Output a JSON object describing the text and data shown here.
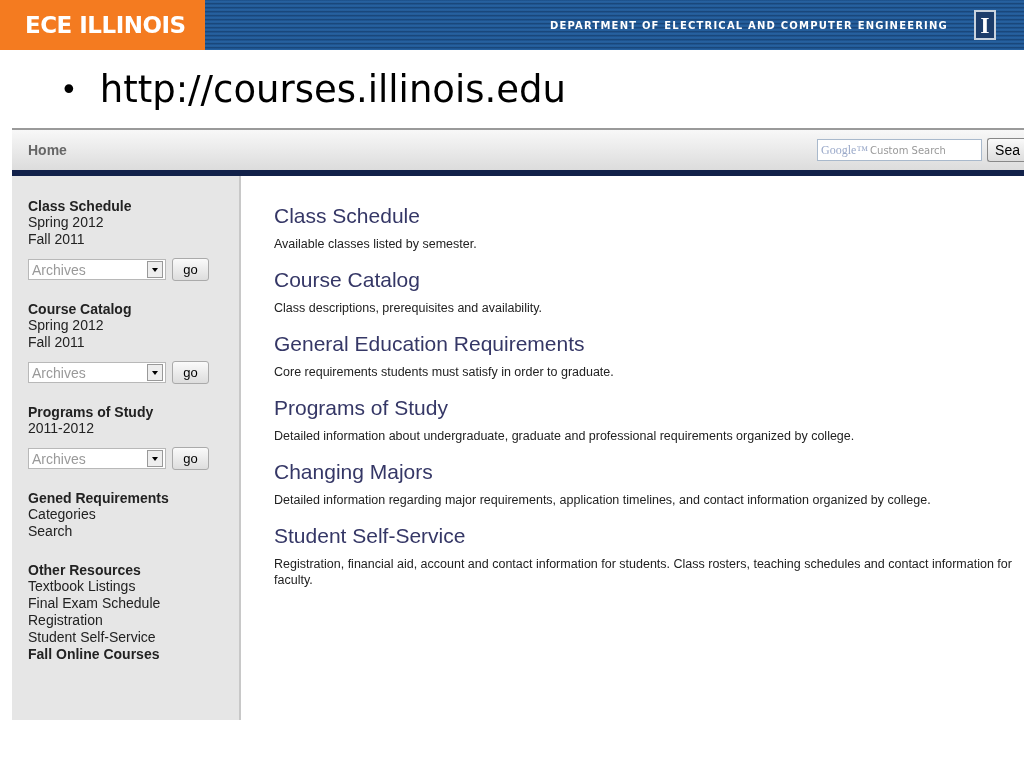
{
  "banner": {
    "logo": "ECE ILLINOIS",
    "department": "DEPARTMENT OF ELECTRICAL AND COMPUTER ENGINEERING",
    "emblem": "I"
  },
  "bullet": {
    "marker": "•",
    "text": "http://courses.illinois.edu"
  },
  "site": {
    "nav": {
      "home": "Home",
      "search_brand": "Google™",
      "search_placeholder": "Custom Search",
      "search_button": "Sea"
    },
    "sidebar": [
      {
        "title": "Class Schedule",
        "links": [
          {
            "label": "Spring 2012",
            "bold": false
          },
          {
            "label": "Fall 2011",
            "bold": false
          }
        ],
        "archive": {
          "placeholder": "Archives",
          "button": "go"
        }
      },
      {
        "title": "Course Catalog",
        "links": [
          {
            "label": "Spring 2012",
            "bold": false
          },
          {
            "label": "Fall 2011",
            "bold": false
          }
        ],
        "archive": {
          "placeholder": "Archives",
          "button": "go"
        }
      },
      {
        "title": "Programs of Study",
        "links": [
          {
            "label": "2011-2012",
            "bold": false
          }
        ],
        "archive": {
          "placeholder": "Archives",
          "button": "go"
        }
      },
      {
        "title": "Gened Requirements",
        "links": [
          {
            "label": "Categories",
            "bold": false
          },
          {
            "label": "Search",
            "bold": false
          }
        ]
      },
      {
        "title": "Other Resources",
        "links": [
          {
            "label": "Textbook Listings",
            "bold": false
          },
          {
            "label": "Final Exam Schedule",
            "bold": false
          },
          {
            "label": "Registration",
            "bold": false
          },
          {
            "label": "Student Self-Service",
            "bold": false
          },
          {
            "label": "Fall Online Courses",
            "bold": true
          }
        ]
      }
    ],
    "sections": [
      {
        "title": "Class Schedule",
        "description": "Available classes listed by semester."
      },
      {
        "title": "Course Catalog",
        "description": "Class descriptions, prerequisites and availability."
      },
      {
        "title": "General Education Requirements",
        "description": "Core requirements students must satisfy in order to graduate."
      },
      {
        "title": "Programs of Study",
        "description": "Detailed information about undergraduate, graduate and professional requirements organized by college."
      },
      {
        "title": "Changing Majors",
        "description": "Detailed information regarding major requirements, application timelines, and contact information organized by college."
      },
      {
        "title": "Student Self-Service",
        "description": "Registration, financial aid, account and contact information for students. Class rosters, teaching schedules and contact information for faculty."
      }
    ]
  }
}
